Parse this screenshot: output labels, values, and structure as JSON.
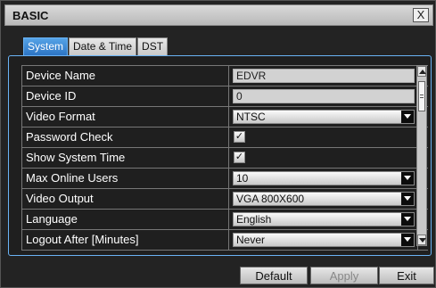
{
  "window": {
    "title": "BASIC",
    "close_glyph": "X"
  },
  "tabs": [
    {
      "label": "System",
      "active": true
    },
    {
      "label": "Date & Time",
      "active": false
    },
    {
      "label": "DST",
      "active": false
    }
  ],
  "rows": [
    {
      "label": "Device Name",
      "type": "text",
      "value": "EDVR"
    },
    {
      "label": "Device ID",
      "type": "text",
      "value": "0"
    },
    {
      "label": "Video Format",
      "type": "select",
      "value": "NTSC"
    },
    {
      "label": "Password Check",
      "type": "checkbox",
      "checked": true
    },
    {
      "label": "Show System Time",
      "type": "checkbox",
      "checked": true
    },
    {
      "label": "Max Online Users",
      "type": "select",
      "value": "10"
    },
    {
      "label": "Video Output",
      "type": "select",
      "value": "VGA 800X600"
    },
    {
      "label": "Language",
      "type": "select",
      "value": "English"
    },
    {
      "label": "Logout After [Minutes]",
      "type": "select",
      "value": "Never"
    }
  ],
  "buttons": {
    "default": "Default",
    "apply": "Apply",
    "exit": "Exit"
  },
  "icons": {
    "check": "✓",
    "close": "close-icon",
    "scroll_up": "arrow-up-icon",
    "scroll_down": "arrow-down-icon"
  },
  "colors": {
    "tab_active": "#2d74c4",
    "panel_border": "#6ab3f5"
  }
}
